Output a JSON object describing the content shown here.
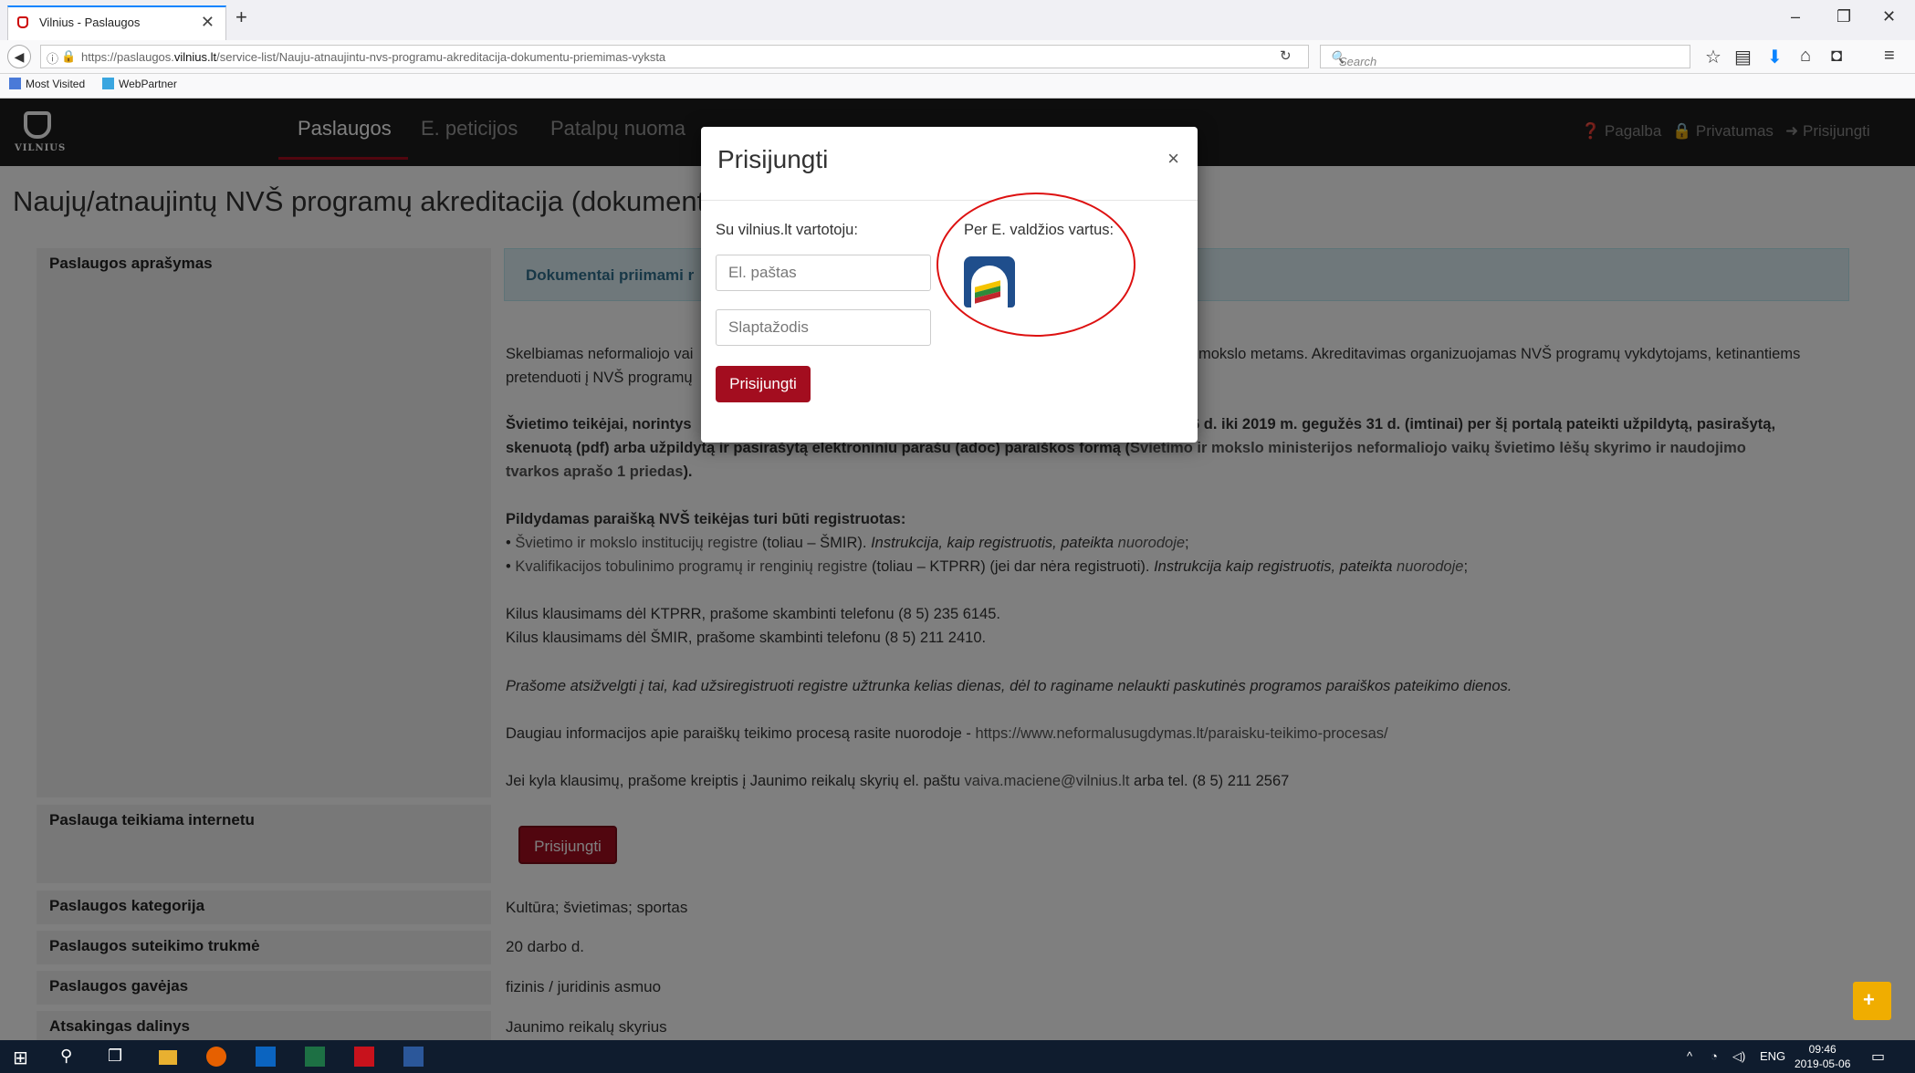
{
  "browser": {
    "tab_title": "Vilnius - Paslaugos",
    "tab_close": "✕",
    "new_tab": "+",
    "url_host": "https://paslaugos.",
    "url_domain": "vilnius.lt",
    "url_path": "/service-list/Nauju-atnaujintu-nvs-programu-akreditacija-dokumentu-priemimas-vyksta",
    "search_placeholder": "Search",
    "bookmarks": [
      "Most Visited",
      "WebPartner"
    ],
    "window_controls": [
      "–",
      "❐",
      "✕"
    ]
  },
  "site": {
    "logo_text": "VILNIUS",
    "nav": [
      "Paslaugos",
      "E. peticijos",
      "Patalpų nuoma"
    ],
    "top_right": [
      "Pagalba",
      "Privatumas",
      "Prisijungti"
    ]
  },
  "page": {
    "title": "Naujų/atnaujintų NVŠ programų akreditacija (dokumentų priėm",
    "side_labels": {
      "description": "Paslaugos aprašymas",
      "online": "Paslauga teikiama internetu",
      "category": "Paslaugos kategorija",
      "duration": "Paslaugos suteikimo trukmė",
      "recipient": "Paslaugos gavėjas",
      "unit": "Atsakingas dalinys"
    },
    "alert": "Dokumentai priimami r",
    "p1_line1_a": "Skelbiamas neformaliojo vai",
    "p1_line1_b": "mokslo metams. Akreditavimas organizuojamas NVŠ programų vykdytojams, ketinantiems",
    "p1_line2": "pretenduoti į NVŠ programų",
    "p2_line1_a": "Švietimo teikėjai, norintys",
    "p2_line1_b": "6 d. iki 2019 m. gegužės 31 d. (imtinai) per šį portalą pateikti užpildytą, pasirašytą,",
    "p2_line2_a": "skenuotą (pdf) arba užpildytą ir pasirašytą elektroniniu parašu (adoc) paraiškos formą (",
    "p2_line2_link": "Švietimo ir mokslo ministerijos neformaliojo vaikų švietimo lėšų skyrimo ir naudojimo",
    "p2_line3_link": "tvarkos aprašo 1 priedas",
    "p2_line3_end": ").",
    "reg_heading": "Pildydamas paraišką NVŠ teikėjas turi būti registruotas:",
    "reg1_a": "• ",
    "reg1_link": "Švietimo ir mokslo institucijų registre",
    "reg1_b": " (toliau – ŠMIR). ",
    "reg1_c": "Instrukcija, kaip registruotis, pateikta ",
    "reg1_link2": "nuorodoje",
    "reg1_end": ";",
    "reg2_a": "• ",
    "reg2_link": "Kvalifikacijos tobulinimo programų ir renginių registre",
    "reg2_b": " (toliau – KTPRR) (jei dar nėra registruoti). ",
    "reg2_c": "Instrukcija kaip registruotis, pateikta ",
    "reg2_link2": "nuorodoje",
    "reg2_end": ";",
    "phone1": "Kilus klausimams dėl KTPRR, prašome skambinti telefonu (8 5) 235 6145.",
    "phone2": "Kilus klausimams dėl ŠMIR, prašome skambinti telefonu (8 5) 211 2410.",
    "notice": "Prašome atsižvelgti į tai, kad užsiregistruoti registre užtrunka kelias dienas, dėl to raginame nelaukti paskutinės programos paraiškos pateikimo dienos.",
    "more_info_a": "Daugiau informacijos apie paraiškų teikimo procesą rasite nuorodoje - ",
    "more_info_link": "https://www.neformalusugdymas.lt/paraisku-teikimo-procesas/",
    "contact_a": "Jei kyla klausimų, prašome kreiptis į Jaunimo reikalų skyrių el. paštu ",
    "contact_email": "vaiva.maciene@vilnius.lt",
    "contact_b": " arba tel. (8 5) 211 2567",
    "login_button": "Prisijungti",
    "category_value": "Kultūra; švietimas; sportas",
    "duration_value": "20 darbo d.",
    "recipient_value": "fizinis / juridinis asmuo",
    "unit_value": "Jaunimo reikalų skyrius"
  },
  "modal": {
    "title": "Prisijungti",
    "close": "×",
    "sub_local": "Su vilnius.lt vartotoju:",
    "sub_gov": "Per E. valdžios vartus:",
    "email_placeholder": "El. paštas",
    "password_placeholder": "Slaptažodis",
    "submit": "Prisijungti"
  },
  "taskbar": {
    "lang": "ENG",
    "time": "09:46",
    "date": "2019-05-06"
  },
  "colors": {
    "brand_red": "#a30d1f",
    "header_bg": "#1c1c1c",
    "alert_bg": "#dff0f6",
    "annotation_red": "#dd1111"
  }
}
